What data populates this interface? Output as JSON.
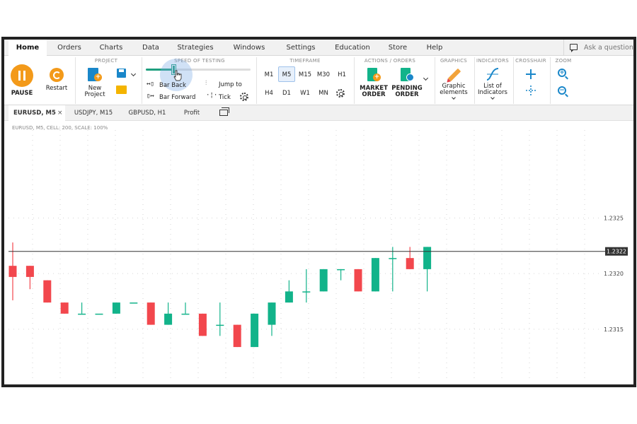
{
  "menu": {
    "items": [
      "Home",
      "Orders",
      "Charts",
      "Data",
      "Strategies",
      "Windows",
      "Settings",
      "Education",
      "Store",
      "Help"
    ],
    "ask_placeholder": "Ask a question"
  },
  "ribbon": {
    "pause_label": "PAUSE",
    "restart_label": "Restart",
    "project": {
      "title": "PROJECT",
      "new_line1": "New",
      "new_line2": "Project"
    },
    "speed": {
      "title": "SPEED OF TESTING",
      "level": 0.27,
      "bar_back": "Bar Back",
      "bar_forward": "Bar Forward",
      "jump_to": "Jump to",
      "tick": "Tick"
    },
    "timeframe": {
      "title": "TIMEFRAME",
      "row1": [
        "M1",
        "M5",
        "M15",
        "M30",
        "H1"
      ],
      "row2": [
        "H4",
        "D1",
        "W1",
        "MN"
      ],
      "active": "M5"
    },
    "actions": {
      "title": "ACTIONS  /  ORDERS",
      "market_line1": "MARKET",
      "market_line2": "ORDER",
      "pending_line1": "PENDING",
      "pending_line2": "ORDER"
    },
    "graphics": {
      "title": "GRAPHICS",
      "line1": "Graphic",
      "line2": "elements"
    },
    "indicators": {
      "title": "INDICATORS",
      "line1": "List of",
      "line2": "Indicators"
    },
    "crosshair": {
      "title": "CROSSHAIR"
    },
    "zoom": {
      "title": "ZOOM"
    }
  },
  "tabs": [
    {
      "label": "EURUSD, M5",
      "active": true,
      "close": "×"
    },
    {
      "label": "USDJPY, M15",
      "active": false
    },
    {
      "label": "GBPUSD, H1",
      "active": false
    },
    {
      "label": "Profit",
      "active": false
    }
  ],
  "chart_info": "EURUSD, M5, CELL: 200, SCALE: 100%",
  "colors": {
    "bull": "#12b38a",
    "bear": "#f2474d",
    "accent": "#f39a1a",
    "brand": "#1a87c9"
  },
  "chart_data": {
    "type": "candlestick",
    "symbol": "EURUSD",
    "timeframe": "M5",
    "y_ticks": [
      1.2325,
      1.232,
      1.2315
    ],
    "ylim": [
      1.23108,
      1.23324
    ],
    "current_price": 1.2322,
    "current_price_label": "1.2322",
    "candles": [
      {
        "o": 1.23207,
        "h": 1.23228,
        "l": 1.23176,
        "c": 1.23197
      },
      {
        "o": 1.23207,
        "h": 1.23207,
        "l": 1.23186,
        "c": 1.23197
      },
      {
        "o": 1.23194,
        "h": 1.23194,
        "l": 1.23174,
        "c": 1.23174
      },
      {
        "o": 1.23174,
        "h": 1.23174,
        "l": 1.23164,
        "c": 1.23164
      },
      {
        "o": 1.23164,
        "h": 1.23174,
        "l": 1.23164,
        "c": 1.23164
      },
      {
        "o": 1.23164,
        "h": 1.23164,
        "l": 1.23164,
        "c": 1.23164
      },
      {
        "o": 1.23164,
        "h": 1.23174,
        "l": 1.23164,
        "c": 1.23174
      },
      {
        "o": 1.23174,
        "h": 1.23174,
        "l": 1.23174,
        "c": 1.23174
      },
      {
        "o": 1.23174,
        "h": 1.23174,
        "l": 1.23154,
        "c": 1.23154
      },
      {
        "o": 1.23154,
        "h": 1.23174,
        "l": 1.23154,
        "c": 1.23164
      },
      {
        "o": 1.23164,
        "h": 1.23174,
        "l": 1.23164,
        "c": 1.23164
      },
      {
        "o": 1.23164,
        "h": 1.23164,
        "l": 1.23144,
        "c": 1.23144
      },
      {
        "o": 1.23154,
        "h": 1.23174,
        "l": 1.23144,
        "c": 1.23154
      },
      {
        "o": 1.23154,
        "h": 1.23154,
        "l": 1.23134,
        "c": 1.23134
      },
      {
        "o": 1.23134,
        "h": 1.23164,
        "l": 1.23134,
        "c": 1.23164
      },
      {
        "o": 1.23154,
        "h": 1.23174,
        "l": 1.23144,
        "c": 1.23174
      },
      {
        "o": 1.23174,
        "h": 1.23194,
        "l": 1.23174,
        "c": 1.23184
      },
      {
        "o": 1.23184,
        "h": 1.23204,
        "l": 1.23174,
        "c": 1.23184
      },
      {
        "o": 1.23184,
        "h": 1.23204,
        "l": 1.23184,
        "c": 1.23204
      },
      {
        "o": 1.23204,
        "h": 1.23204,
        "l": 1.23194,
        "c": 1.23204
      },
      {
        "o": 1.23204,
        "h": 1.23204,
        "l": 1.23184,
        "c": 1.23184
      },
      {
        "o": 1.23184,
        "h": 1.23214,
        "l": 1.23184,
        "c": 1.23214
      },
      {
        "o": 1.23214,
        "h": 1.23224,
        "l": 1.23184,
        "c": 1.23214
      },
      {
        "o": 1.23214,
        "h": 1.23224,
        "l": 1.23204,
        "c": 1.23204
      },
      {
        "o": 1.23204,
        "h": 1.23224,
        "l": 1.23184,
        "c": 1.23224
      }
    ]
  }
}
